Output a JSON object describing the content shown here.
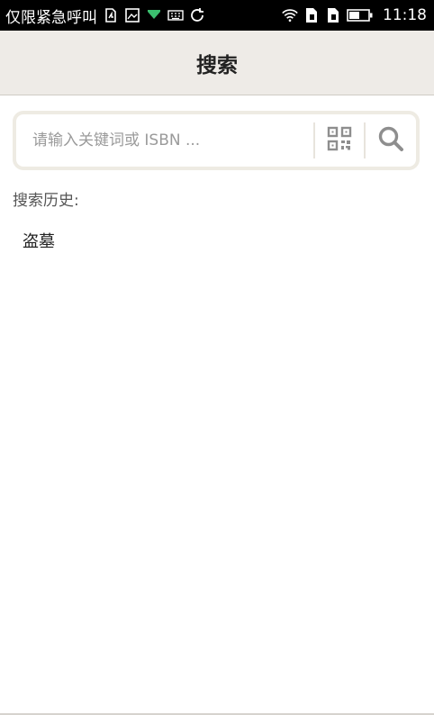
{
  "status_bar": {
    "carrier": "仅限紧急呼叫",
    "time": "11:18",
    "icons_left": [
      "sim-icon",
      "image-icon",
      "download-icon",
      "keyboard-icon",
      "sync-icon"
    ],
    "icons_right": [
      "wifi-icon",
      "sim1-icon",
      "sim2-icon",
      "battery-icon"
    ]
  },
  "appbar": {
    "title": "搜索"
  },
  "search": {
    "placeholder": "请输入关键词或 ISBN ...",
    "value": "",
    "qr_icon": "qr-code-icon",
    "search_icon": "search-icon"
  },
  "history": {
    "label": "搜索历史:",
    "items": [
      "盗墓"
    ]
  },
  "colors": {
    "status_bar_bg": "#000000",
    "appbar_bg": "#eeebe7",
    "search_border": "#eeebe3",
    "icon_gray": "#8e8e8e"
  }
}
